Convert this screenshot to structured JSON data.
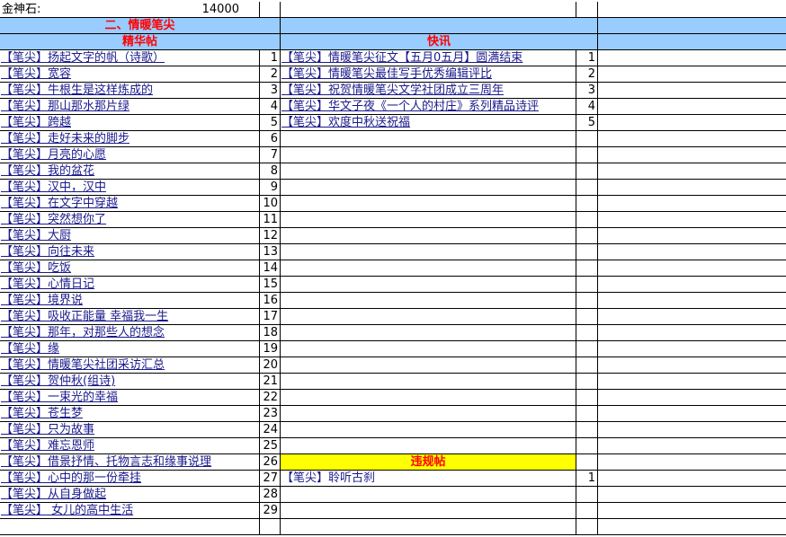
{
  "top": {
    "label": "金神石:",
    "value": "14000"
  },
  "section_title": "二、情暖笔尖",
  "headers": {
    "left": "精华帖",
    "right": "快讯"
  },
  "jinghua": [
    {
      "title": "【笔尖】扬起文字的帆（诗歌）",
      "num": "1"
    },
    {
      "title": "【笔尖】宽容",
      "num": "2"
    },
    {
      "title": "【笔尖】牛根生是这样炼成的",
      "num": "3"
    },
    {
      "title": "【笔尖】那山那水那片绿",
      "num": "4"
    },
    {
      "title": "【笔尖】跨越",
      "num": "5"
    },
    {
      "title": "【笔尖】走好未来的脚步",
      "num": "6"
    },
    {
      "title": "【笔尖】月亮的心愿",
      "num": "7"
    },
    {
      "title": "【笔尖】我的盆花",
      "num": "8"
    },
    {
      "title": "【笔尖】汉中，汉中",
      "num": "9"
    },
    {
      "title": "【笔尖】在文字中穿越",
      "num": "10"
    },
    {
      "title": "【笔尖】突然想你了",
      "num": "11"
    },
    {
      "title": "【笔尖】大厨",
      "num": "12"
    },
    {
      "title": "【笔尖】向往未来",
      "num": "13"
    },
    {
      "title": "【笔尖】吃饭",
      "num": "14"
    },
    {
      "title": "【笔尖】心情日记",
      "num": "15"
    },
    {
      "title": "【笔尖】境界说",
      "num": "16"
    },
    {
      "title": "【笔尖】吸收正能量 幸福我一生",
      "num": "17"
    },
    {
      "title": "【笔尖】那年，对那些人的想念",
      "num": "18"
    },
    {
      "title": "【笔尖】缘",
      "num": "19"
    },
    {
      "title": "【笔尖】情暖笔尖社团采访汇总",
      "num": "20"
    },
    {
      "title": "【笔尖】贺仲秋(组诗)",
      "num": "21"
    },
    {
      "title": "【笔尖】一束光的幸福",
      "num": "22"
    },
    {
      "title": "【笔尖】苍生梦",
      "num": "23"
    },
    {
      "title": "【笔尖】只为故事",
      "num": "24"
    },
    {
      "title": "【笔尖】难忘恩师",
      "num": "25"
    },
    {
      "title": "【笔尖】借景抒情、托物言志和缘事说理",
      "num": "26"
    },
    {
      "title": "【笔尖】心中的那一份牵挂",
      "num": "27"
    },
    {
      "title": "【笔尖】从自身做起",
      "num": "28"
    },
    {
      "title": "【笔尖】 女儿的高中生活",
      "num": "29"
    }
  ],
  "kuaixun": [
    {
      "title": "【笔尖】情暖笔尖征文【五月0五月】圆满结束",
      "num": "1"
    },
    {
      "title": "【笔尖】情暖笔尖最佳写手优秀编辑评比",
      "num": "2"
    },
    {
      "title": "【笔尖】祝贺情暖笔尖文学社团成立三周年",
      "num": "3"
    },
    {
      "title": "【笔尖】华文子夜《一个人的村庄》系列精品诗评",
      "num": "4"
    },
    {
      "title": "【笔尖】欢度中秋送祝福",
      "num": "5"
    }
  ],
  "violation": {
    "header": "违规帖",
    "items": [
      {
        "title": "【笔尖】聆听古刹",
        "num": "1"
      }
    ]
  }
}
